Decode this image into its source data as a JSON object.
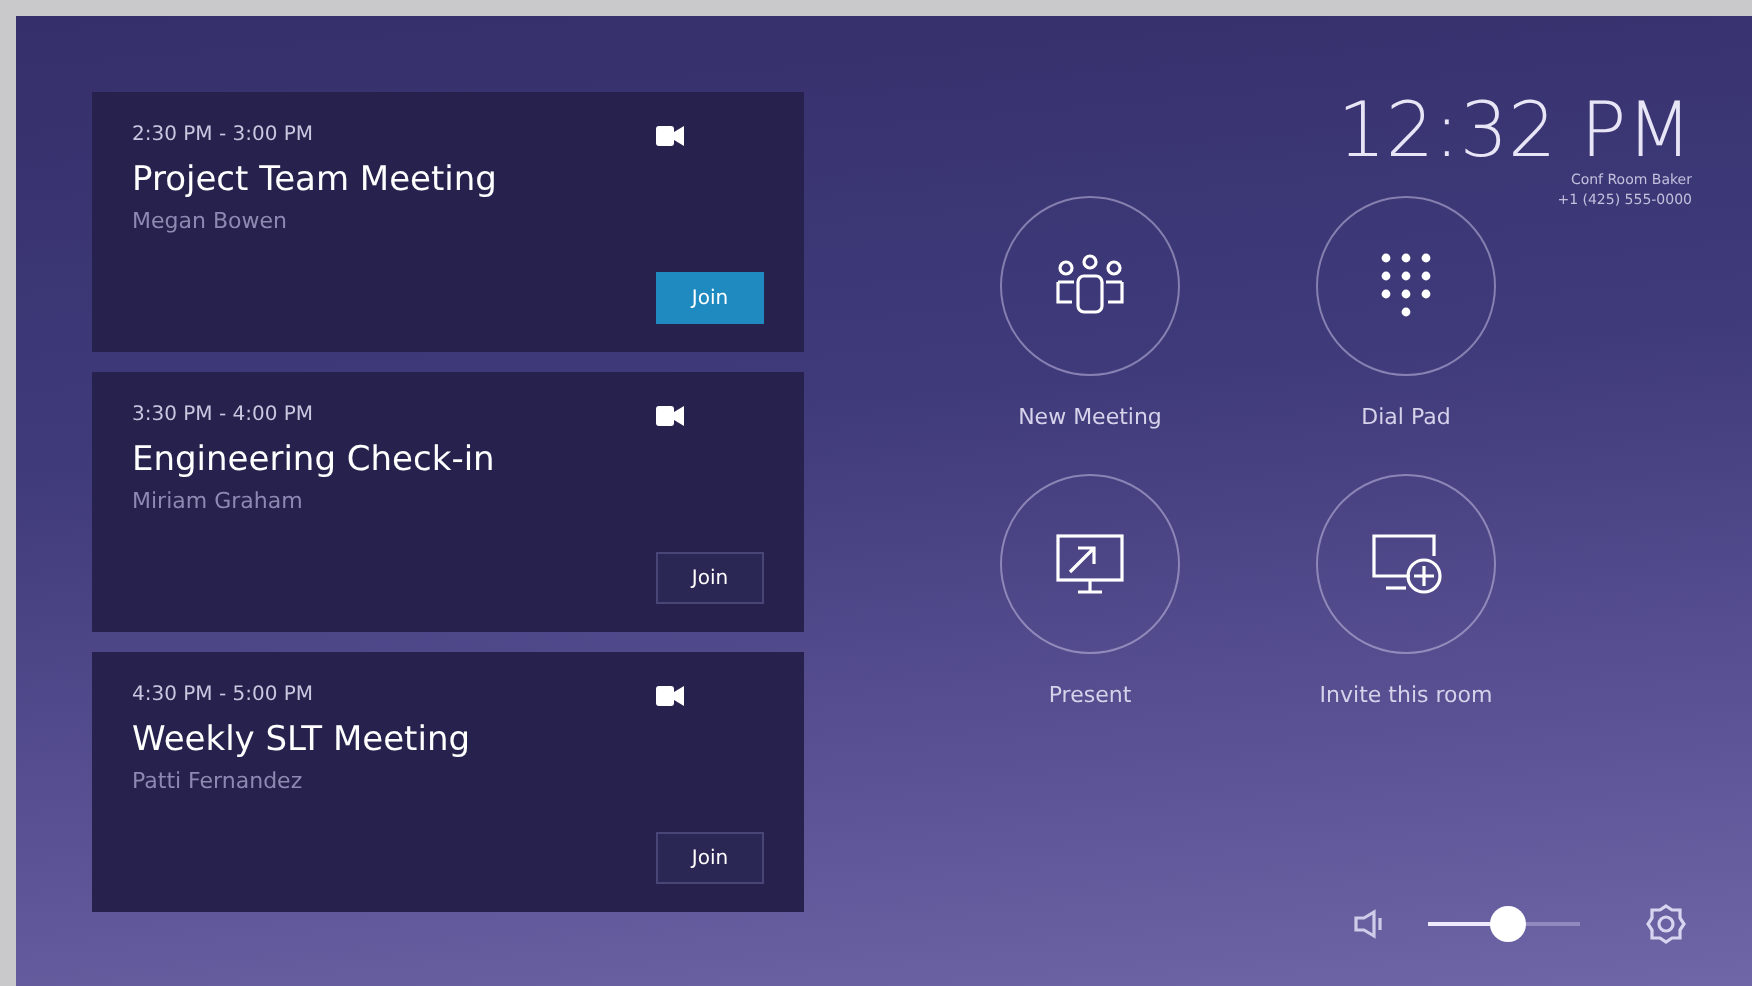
{
  "meetings": [
    {
      "time": "2:30 PM - 3:00 PM",
      "title": "Project Team Meeting",
      "organizer": "Megan Bowen",
      "join": {
        "label": "Join",
        "highlighted": true
      }
    },
    {
      "time": "3:30 PM - 4:00 PM",
      "title": "Engineering Check-in",
      "organizer": "Miriam Graham",
      "join": {
        "label": "Join",
        "highlighted": false
      }
    },
    {
      "time": "4:30 PM - 5:00 PM",
      "title": "Weekly SLT Meeting",
      "organizer": "Patti Fernandez",
      "join": {
        "label": "Join",
        "highlighted": false
      }
    }
  ],
  "clock": {
    "time": "12:32 PM",
    "room": "Conf Room Baker",
    "phone": "+1 (425) 555-0000"
  },
  "actions": [
    {
      "kind": "new-meeting",
      "label": "New Meeting"
    },
    {
      "kind": "dial-pad",
      "label": "Dial Pad"
    },
    {
      "kind": "present",
      "label": "Present"
    },
    {
      "kind": "invite",
      "label": "Invite this room"
    }
  ],
  "volume": {
    "level": 0.53
  }
}
